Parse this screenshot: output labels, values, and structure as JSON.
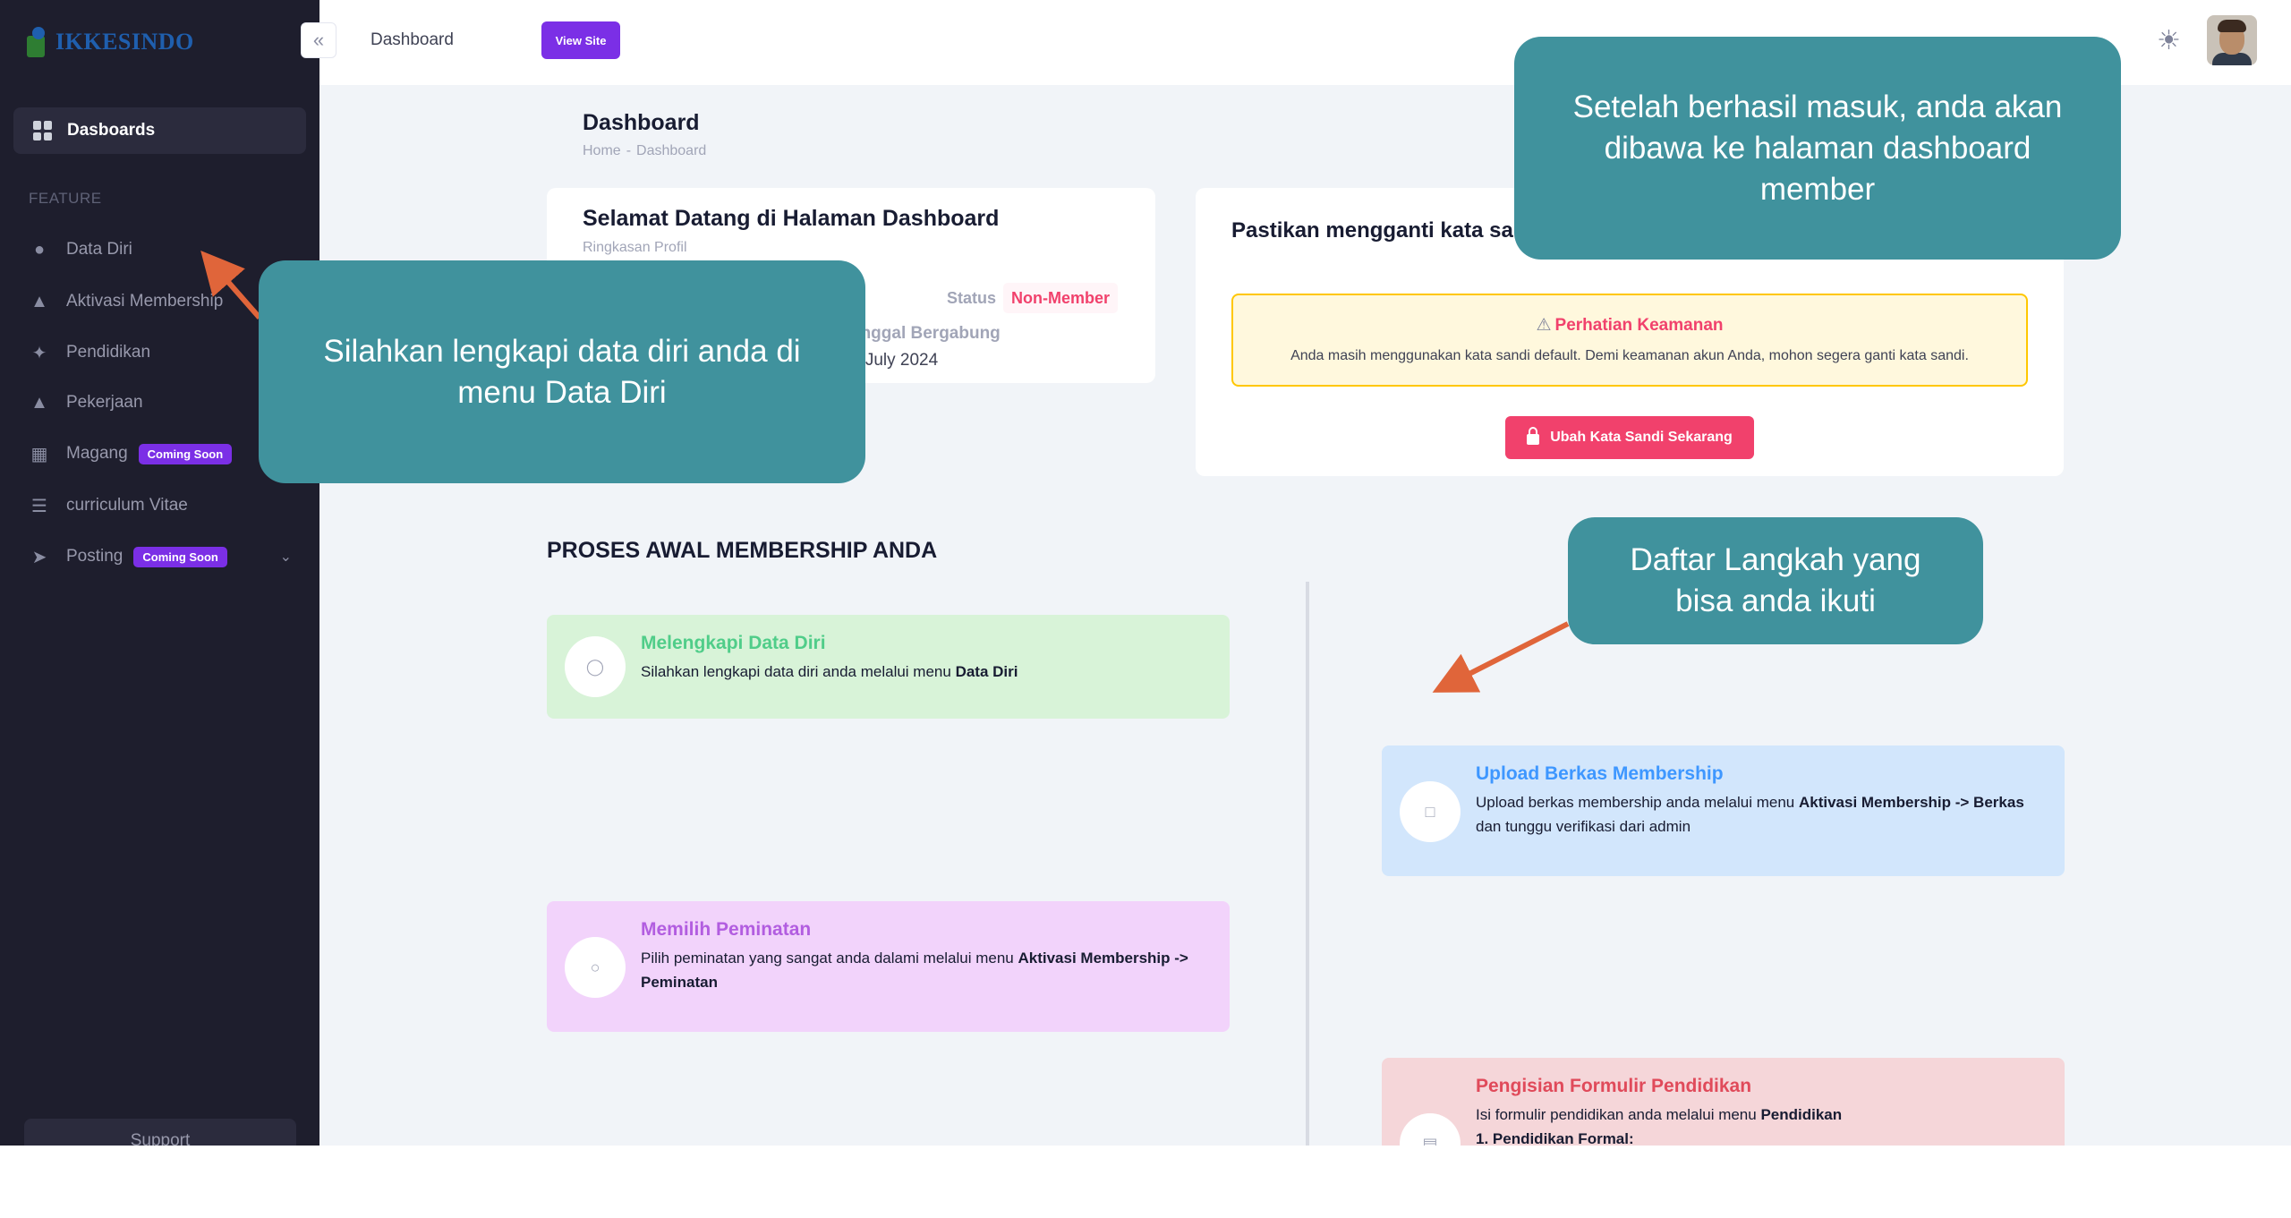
{
  "sidebar": {
    "logo_text": "IKKESINDO",
    "active_item": "Dasboards",
    "section_heading": "FEATURE",
    "items": [
      {
        "label": "Data Diri",
        "icon": "user-icon"
      },
      {
        "label": "Aktivasi Membership",
        "icon": "membership-icon"
      },
      {
        "label": "Pendidikan",
        "icon": "education-icon"
      },
      {
        "label": "Pekerjaan",
        "icon": "bank-icon"
      },
      {
        "label": "Magang",
        "icon": "layout-icon",
        "badge": "Coming Soon"
      },
      {
        "label": "curriculum Vitae",
        "icon": "cv-icon"
      },
      {
        "label": "Posting",
        "icon": "rocket-icon",
        "badge": "Coming Soon"
      }
    ],
    "support_label": "Support"
  },
  "header": {
    "title": "Dashboard",
    "view_site_label": "View Site",
    "collapse_icon": "«",
    "theme_icon": "☀"
  },
  "page": {
    "title": "Dashboard",
    "breadcrumb": [
      "Home",
      "Dashboard"
    ],
    "breadcrumb_sep": "-"
  },
  "welcome_card": {
    "title": "Selamat Datang di Halaman Dashboard",
    "subtitle": "Ringkasan Profil",
    "status_label": "Status",
    "status_value": "Non-Member",
    "joined_label": "anggal Bergabung",
    "joined_value": "4 July 2024"
  },
  "password_card": {
    "title": "Pastikan mengganti kata sar",
    "alert_title": "Perhatian Keamanan",
    "alert_text": "Anda masih menggunakan kata sandi default. Demi keamanan akun Anda, mohon segera ganti kata sandi.",
    "button_label": "Ubah Kata Sandi Sekarang"
  },
  "process": {
    "heading": "PROSES AWAL MEMBERSHIP ANDA",
    "steps": [
      {
        "title": "Melengkapi Data Diri",
        "desc_pre": "Silahkan lengkapi data diri anda melalui menu ",
        "desc_bold": "Data Diri",
        "desc_post": "",
        "color": "#50cd89"
      },
      {
        "title": "Upload Berkas Membership",
        "desc_pre": "Upload berkas membership anda melalui menu ",
        "desc_bold": "Aktivasi Membership -> Berkas",
        "desc_post": " dan tunggu verifikasi dari admin",
        "color": "#3e97ff"
      },
      {
        "title": "Memilih Peminatan",
        "desc_pre": "Pilih peminatan yang sangat anda dalami melalui menu ",
        "desc_bold": "Aktivasi Membership -> Peminatan",
        "desc_post": "",
        "color": "#b25de0"
      },
      {
        "title": "Pengisian Formulir Pendidikan",
        "desc_pre": "Isi formulir pendidikan anda melalui menu ",
        "desc_bold": "Pendidikan",
        "desc_post": "",
        "line2": "1. Pendidikan Formal:",
        "color": "#e04a5a"
      }
    ]
  },
  "callouts": {
    "c1": "Setelah berhasil masuk, anda akan dibawa ke halaman dashboard member",
    "c2_pre": "Silahkan lengkapi data diri anda di menu ",
    "c2_bold": "Data Diri",
    "c3": "Daftar Langkah yang bisa anda ikuti"
  },
  "colors": {
    "sidebar_bg": "#1e1e2d",
    "accent_purple": "#7b2fe6",
    "danger": "#f1416c",
    "callout_bg": "#40929d",
    "arrow": "#e0653a"
  }
}
